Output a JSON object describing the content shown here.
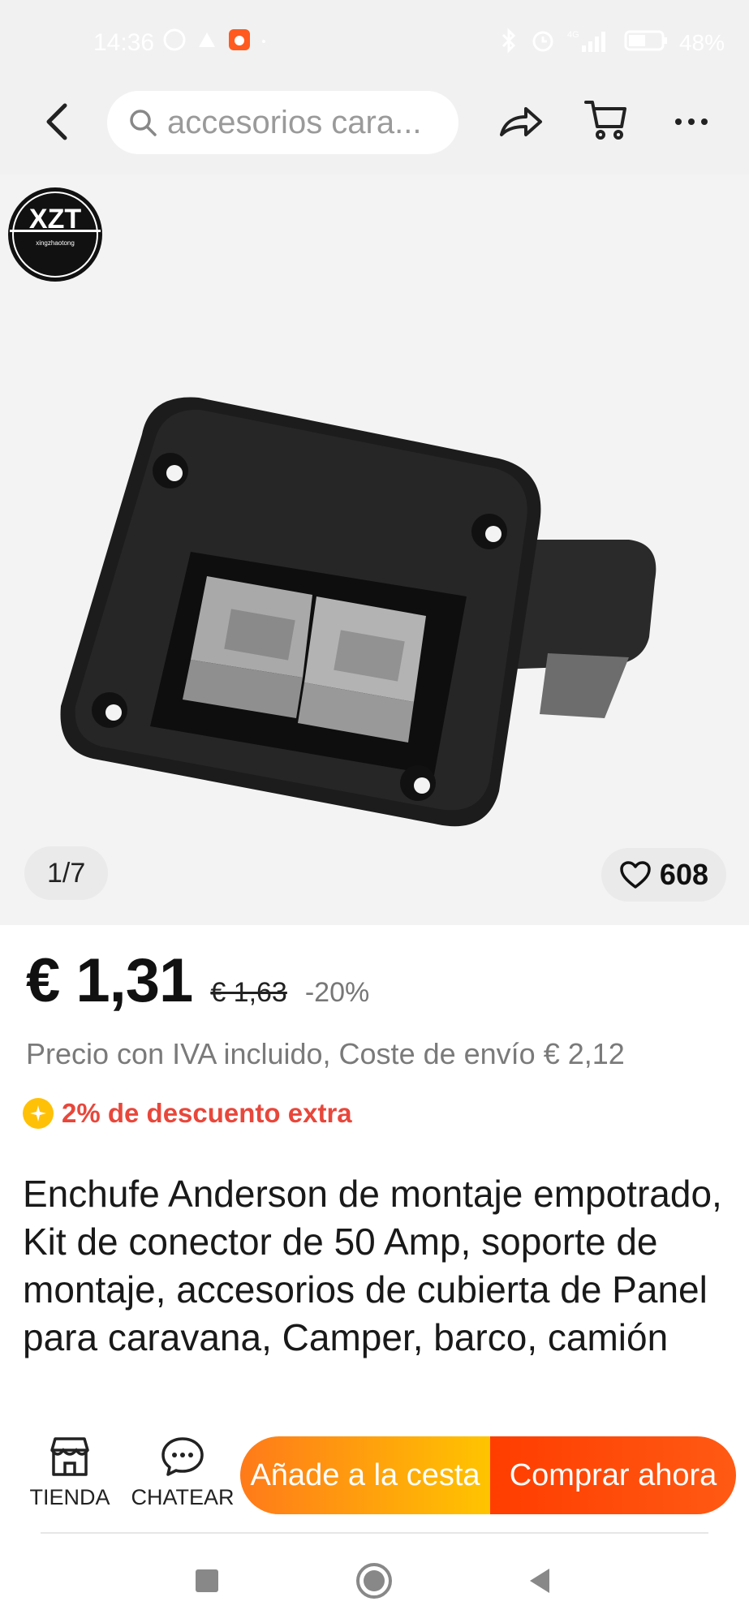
{
  "status_bar": {
    "time": "14:36",
    "battery": "48%",
    "network": "4G"
  },
  "nav": {
    "search_placeholder": "accesorios cara..."
  },
  "gallery": {
    "brand_logo_text": "XZT",
    "brand_logo_subtext": "xingzhaotong",
    "counter": "1/7",
    "wishlist_count": "608"
  },
  "price": {
    "current": "€ 1,31",
    "original": "€ 1,63",
    "discount": "-20%",
    "note": "Precio con IVA incluido, Coste de envío € 2,12",
    "extra_discount": "2% de descuento extra"
  },
  "product": {
    "title": "Enchufe Anderson de montaje empotrado, Kit de conector de 50 Amp, soporte de montaje, accesorios de cubierta de Panel para caravana, Camper, barco, camión"
  },
  "actions": {
    "store_label": "TIENDA",
    "chat_label": "CHATEAR",
    "add_to_cart": "Añade a la cesta",
    "buy_now": "Comprar ahora"
  },
  "colors": {
    "accent_orange": "#ff7a1a",
    "accent_red": "#ff3d00",
    "discount_red": "#e8473b",
    "badge_yellow": "#ffc107"
  }
}
